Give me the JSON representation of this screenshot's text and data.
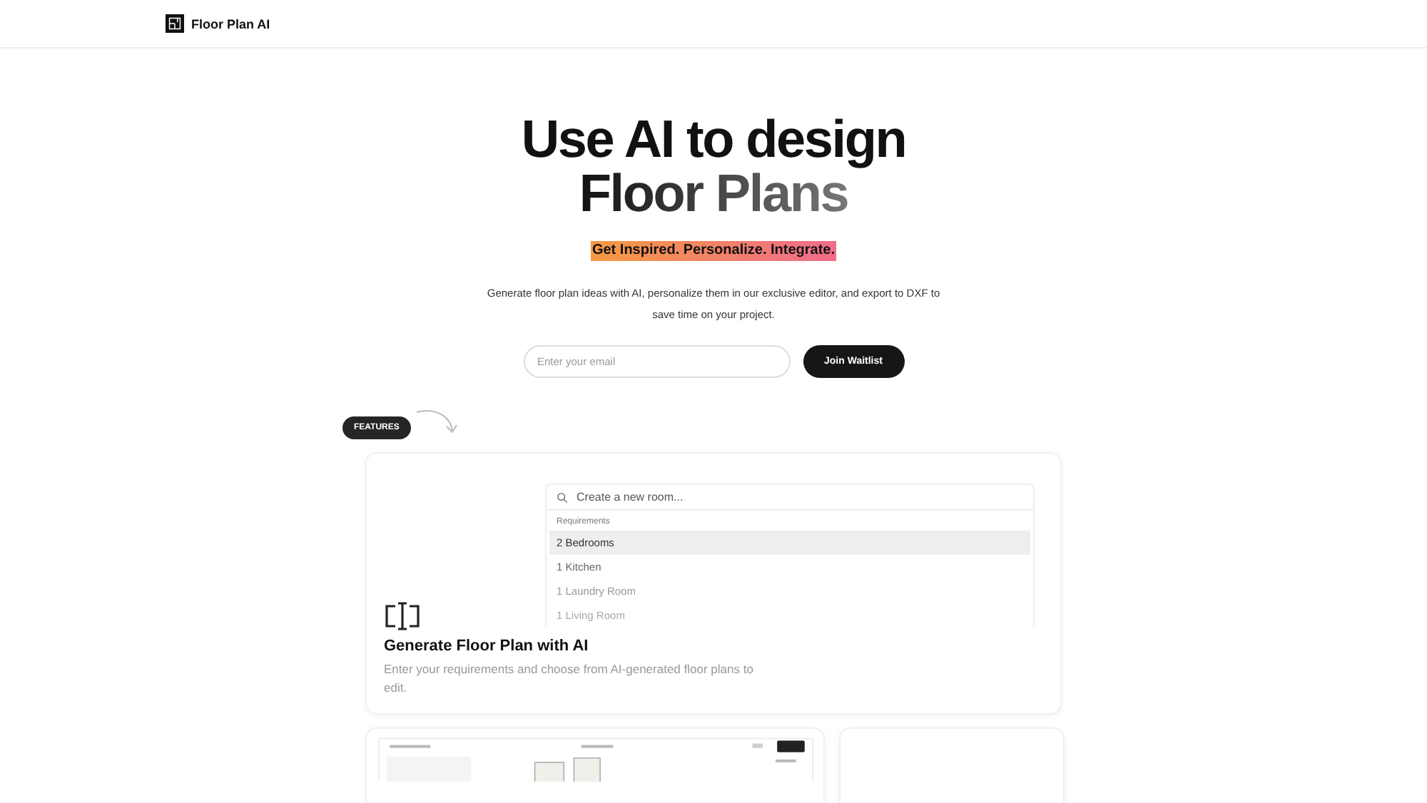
{
  "header": {
    "brand": "Floor Plan AI"
  },
  "hero": {
    "title_line_1": "Use AI to design",
    "title_line_2": "Floor Plans",
    "tagline": "Get Inspired. Personalize. Integrate.",
    "description": "Generate floor plan ideas with AI, personalize them in our exclusive editor, and export to DXF to save time on your project.",
    "email": {
      "placeholder": "Enter your email"
    },
    "button": "Join Waitlist"
  },
  "features_badge": "FEATURES",
  "feature_card": {
    "search": {
      "placeholder": "Create a new room..."
    },
    "group_label": "Requirements",
    "items": [
      {
        "label": "2 Bedrooms",
        "selected": true
      },
      {
        "label": "1 Kitchen",
        "selected": false
      },
      {
        "label": "1 Laundry Room",
        "selected": false
      },
      {
        "label": "1 Living Room",
        "selected": false
      }
    ],
    "title": "Generate Floor Plan with AI",
    "description": "Enter your requirements and choose from AI-generated floor plans to edit."
  }
}
